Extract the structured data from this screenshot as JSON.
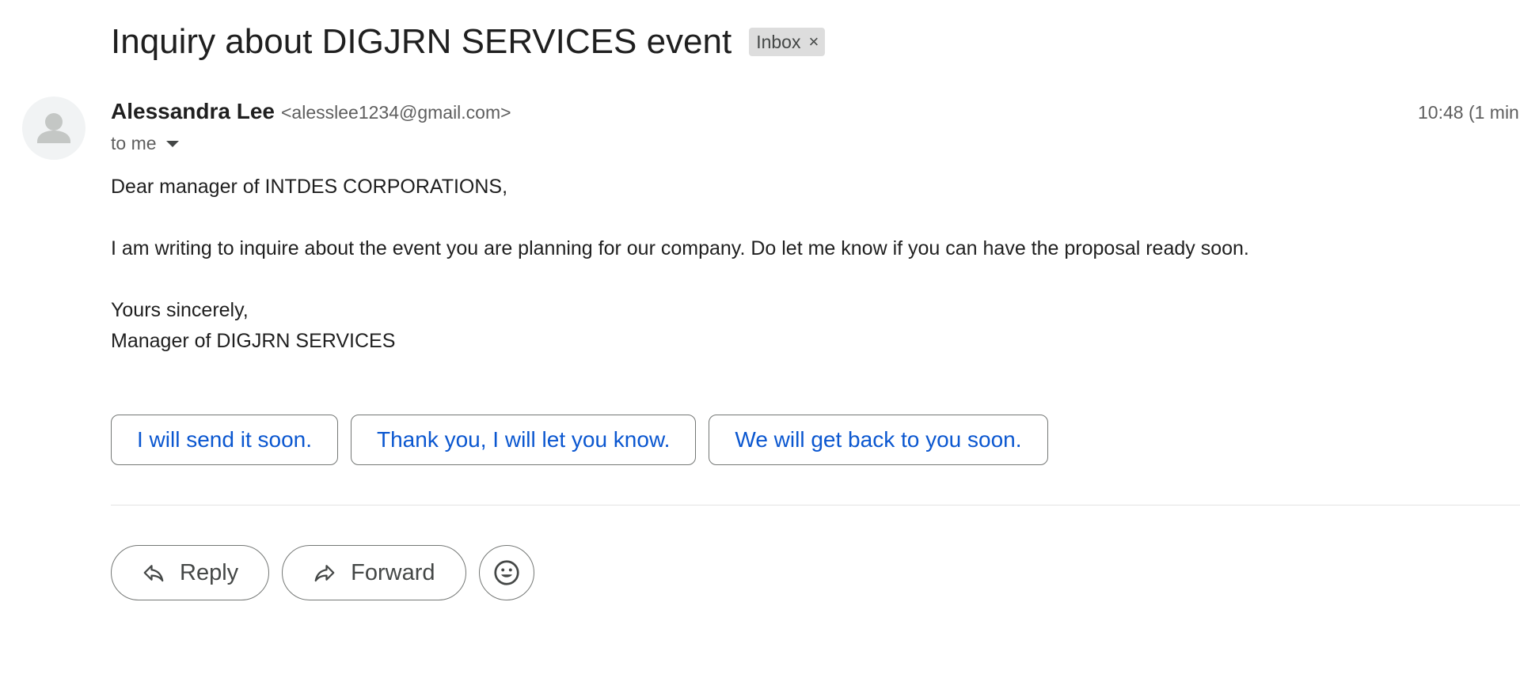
{
  "email": {
    "subject": "Inquiry about DIGJRN SERVICES event",
    "label": {
      "text": "Inbox",
      "remove_glyph": "×"
    },
    "sender": {
      "name": "Alessandra Lee",
      "email": "<alesslee1234@gmail.com>",
      "avatar_icon": "person-icon"
    },
    "timestamp": "10:48 (1 min",
    "recipient": "to me",
    "body": {
      "greeting": "Dear manager of INTDES CORPORATIONS,",
      "paragraph": "I am writing to inquire about the event you are planning for our company. Do let me know if you can have the proposal ready soon.",
      "closing": "Yours sincerely,",
      "signature": "Manager of DIGJRN SERVICES"
    }
  },
  "smart_replies": [
    "I will send it soon.",
    "Thank you, I will let you know.",
    "We will get back to you soon."
  ],
  "actions": {
    "reply_label": "Reply",
    "forward_label": "Forward",
    "reply_icon": "reply-icon",
    "forward_icon": "forward-icon",
    "emoji_icon": "emoji-icon"
  },
  "colors": {
    "smart_reply_text": "#0b57d0",
    "chip_background": "#dddddd",
    "border": "#747775"
  }
}
